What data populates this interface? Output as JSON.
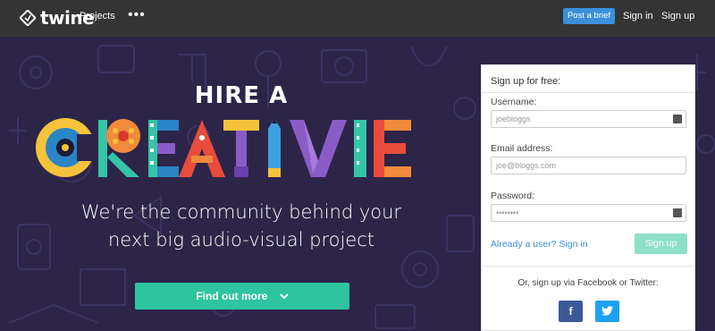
{
  "header": {
    "logo_text": "twine",
    "nav_projects": "Projects",
    "nav_more": "•••",
    "post_brief": "Post a brief",
    "sign_in": "Sign in",
    "sign_up": "Sign up"
  },
  "hero": {
    "hire_a": "HIRE A",
    "creative_word": "CREATIVE",
    "tagline_line1": "We're the community behind your",
    "tagline_line2": "next big audio-visual project",
    "find_out_more": "Find out more"
  },
  "signup": {
    "title": "Sign up for free:",
    "username_label": "Username:",
    "username_placeholder": "joebloggs",
    "email_label": "Email address:",
    "email_placeholder": "joe@bloggs.com",
    "password_label": "Password:",
    "password_placeholder": "••••••••",
    "already_user": "Already a user? Sign in",
    "sign_up_button": "Sign up",
    "via_text": "Or, sign up via Facebook or Twitter:",
    "facebook_label": "f"
  },
  "colors": {
    "accent_blue": "#3b8fdb",
    "accent_green": "#2ec4a0",
    "hero_bg": "#2d2548",
    "topbar_bg": "#343434"
  }
}
